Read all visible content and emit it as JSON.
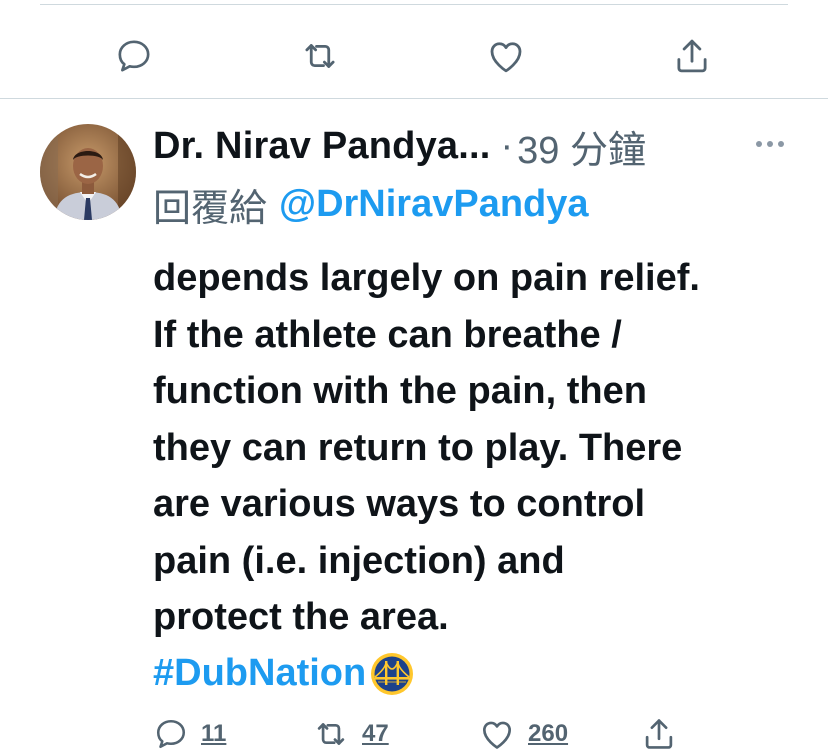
{
  "previous_tweet_actions": {
    "reply_icon": "reply-icon",
    "retweet_icon": "retweet-icon",
    "like_icon": "heart-icon",
    "share_icon": "share-icon"
  },
  "tweet": {
    "display_name": "Dr. Nirav Pandya...",
    "separator": "·",
    "time_ago": "39 分鐘",
    "reply_label": "回覆給",
    "reply_to": "@DrNiravPandya",
    "body_lines": [
      "depends largely on pain relief.",
      "If the athlete can breathe /",
      "function with the pain, then",
      "they can return to play. There",
      "are various ways to control",
      "pain (i.e. injection) and",
      "protect the area."
    ],
    "hashtag": "#DubNation",
    "hashflag_icon": "golden-state-warriors-bridge-icon",
    "replies": "11",
    "retweets": "47",
    "likes": "260"
  },
  "colors": {
    "text": "#0f1419",
    "secondary": "#536471",
    "link": "#1d9bf0",
    "divider": "#cfd9de",
    "warriors_blue": "#1d428a",
    "warriors_gold": "#ffc72c"
  }
}
